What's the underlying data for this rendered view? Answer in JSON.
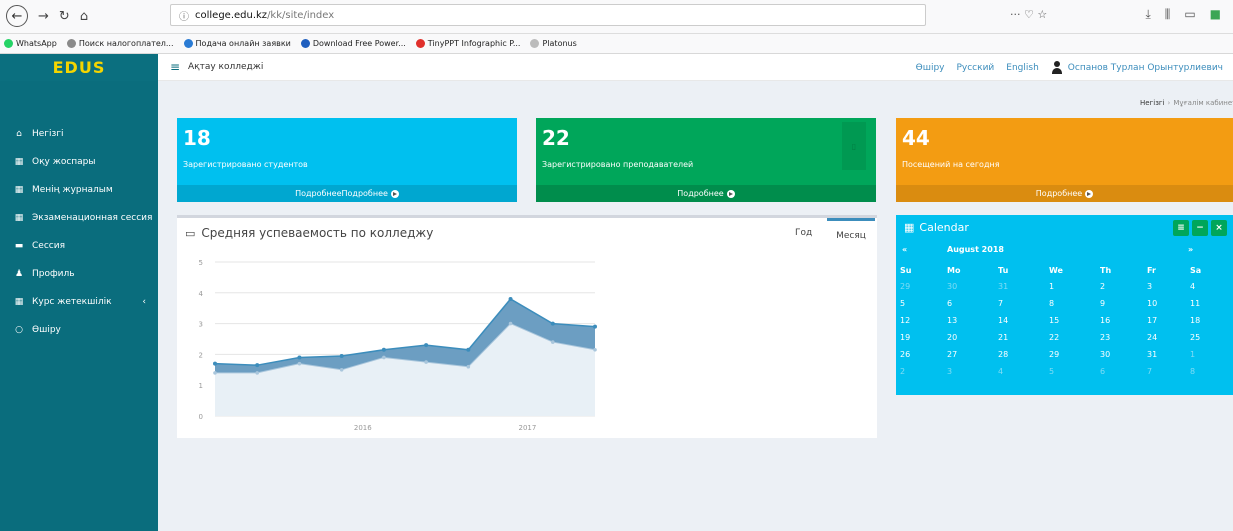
{
  "browser": {
    "url_info": "ⓘ",
    "url_domain": "college.edu.kz",
    "url_path": "/kk/site/index",
    "url_actions": "··· ♡ ☆",
    "bookmarks": [
      {
        "label": "WhatsApp",
        "color": "#25d366"
      },
      {
        "label": "Поиск налогоплател...",
        "color": "#8a8a8a"
      },
      {
        "label": "Подача онлайн заявки",
        "color": "#2a7bd4"
      },
      {
        "label": "Download Free Power...",
        "color": "#1f5fbf"
      },
      {
        "label": "TinyPPT Infographic P...",
        "color": "#e0302b"
      },
      {
        "label": "Platonus",
        "color": "#bbbbbb"
      }
    ]
  },
  "app": {
    "logo": "EDUS",
    "college": "Ақтау колледжі",
    "top_links": [
      "Өшіру",
      "Русский",
      "English"
    ],
    "user_name": "Оспанов Турлан Орынтурлиевич"
  },
  "sidebar": {
    "items": [
      {
        "icon": "home-icon",
        "glyph": "⌂",
        "label": "Негізгі"
      },
      {
        "icon": "table-icon",
        "glyph": "▦",
        "label": "Оқу жоспары"
      },
      {
        "icon": "table-icon",
        "glyph": "▦",
        "label": "Менің журналым"
      },
      {
        "icon": "table-icon",
        "glyph": "▦",
        "label": "Экзаменационная сессия"
      },
      {
        "icon": "list-icon",
        "glyph": "▬",
        "label": "Сессия"
      },
      {
        "icon": "user-icon",
        "glyph": "♟",
        "label": "Профиль"
      },
      {
        "icon": "table-icon",
        "glyph": "▦",
        "label": "Курс жетекшілік",
        "caret": "‹"
      },
      {
        "icon": "circle-icon",
        "glyph": "○",
        "label": "Өшіру"
      }
    ]
  },
  "breadcrumb": {
    "home": "Негізгі",
    "sep": "›",
    "current": "Мұғалім кабинеті"
  },
  "stats": [
    {
      "value": "18",
      "label": "Зарегистрировано студентов",
      "footer": "ПодробнееПодробнее",
      "color": "#00c0ef"
    },
    {
      "value": "22",
      "label": "Зарегистрировано преподавателей",
      "footer": "Подробнее",
      "color": "#00a65a"
    },
    {
      "value": "44",
      "label": "Посещений на сегодня",
      "footer": "Подробнее",
      "color": "#f39c12"
    }
  ],
  "chart_box": {
    "title": "Средняя успеваемость по колледжу",
    "tabs": [
      "Год",
      "Месяц"
    ],
    "active_tab": "Месяц"
  },
  "chart_data": {
    "type": "area",
    "x_tick_labels": [
      "2016",
      "2017"
    ],
    "y_ticks": [
      0,
      1,
      2,
      3,
      4,
      5
    ],
    "ylim": [
      0,
      5
    ],
    "grid": true,
    "series": [
      {
        "values": [
          1.7,
          1.65,
          1.9,
          1.95,
          2.15,
          2.3,
          2.15,
          3.8,
          3.0,
          2.9
        ],
        "color": "#3c8dbc"
      },
      {
        "values": [
          1.4,
          1.4,
          1.7,
          1.5,
          1.9,
          1.75,
          1.6,
          3.0,
          2.4,
          2.15
        ],
        "color": "#c1d7e6"
      }
    ],
    "x_points": [
      0,
      1,
      2,
      3,
      4,
      5,
      6,
      7,
      8,
      9
    ],
    "x_tick_positions": [
      3.5,
      7.4
    ]
  },
  "calendar": {
    "title": "Calendar",
    "month": "August 2018",
    "prev": "«",
    "next": "»",
    "tools": [
      "≡",
      "−",
      "×"
    ],
    "days": [
      "Su",
      "Mo",
      "Tu",
      "We",
      "Th",
      "Fr",
      "Sa"
    ],
    "weeks": [
      [
        "29",
        "30",
        "31",
        "1",
        "2",
        "3",
        "4"
      ],
      [
        "5",
        "6",
        "7",
        "8",
        "9",
        "10",
        "11"
      ],
      [
        "12",
        "13",
        "14",
        "15",
        "16",
        "17",
        "18"
      ],
      [
        "19",
        "20",
        "21",
        "22",
        "23",
        "24",
        "25"
      ],
      [
        "26",
        "27",
        "28",
        "29",
        "30",
        "31",
        "1"
      ],
      [
        "2",
        "3",
        "4",
        "5",
        "6",
        "7",
        "8"
      ]
    ],
    "muted_first_row": 3,
    "muted_last_row_from": 6
  }
}
